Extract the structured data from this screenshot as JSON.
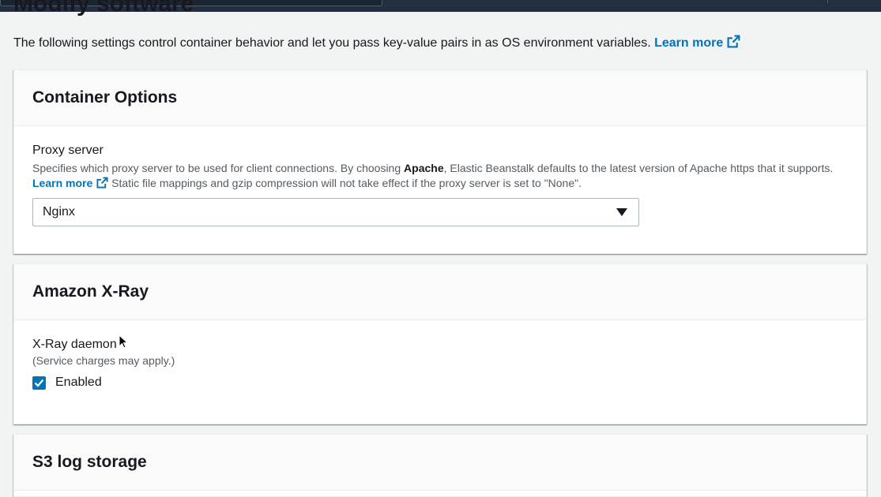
{
  "page": {
    "title": "Modify software",
    "intro_text": "The following settings control container behavior and let you pass key-value pairs in as OS environment variables.",
    "intro_link": "Learn more"
  },
  "container_options": {
    "heading": "Container Options",
    "proxy_label": "Proxy server",
    "desc_part1": "Specifies which proxy server to be used for client connections. By choosing ",
    "desc_bold": "Apache",
    "desc_part2": ", Elastic Beanstalk defaults to the latest version of Apache https that it supports.",
    "desc_link": "Learn more",
    "desc_part3": "Static file mappings and gzip compression will not take effect if the proxy server is set to \"None\".",
    "proxy_value": "Nginx"
  },
  "xray": {
    "heading": "Amazon X-Ray",
    "daemon_label": "X-Ray daemon",
    "daemon_note": "(Service charges may apply.)",
    "enabled_label": "Enabled",
    "enabled_checked": true
  },
  "s3_logs": {
    "heading": "S3 log storage"
  },
  "colors": {
    "link": "#0073bb",
    "topbar": "#232f3e",
    "checkbox": "#0073bb"
  }
}
